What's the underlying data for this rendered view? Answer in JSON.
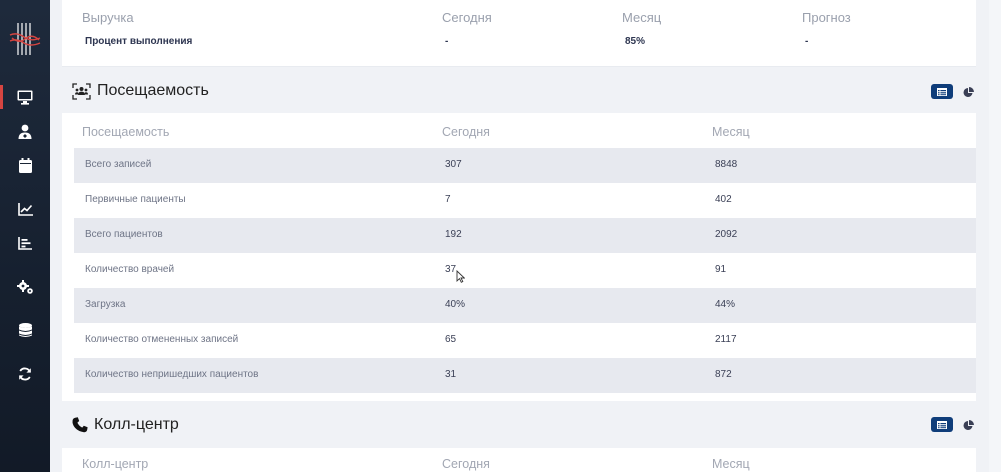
{
  "colors": {
    "sidebar": "#1a2535",
    "accent": "#d64541",
    "button": "#0f3d7a"
  },
  "sidebar": {
    "items": [
      {
        "icon": "monitor-icon",
        "active": true
      },
      {
        "icon": "doctor-icon",
        "active": false
      },
      {
        "icon": "calendar-icon",
        "active": false
      },
      {
        "icon": "line-chart-icon",
        "active": false
      },
      {
        "icon": "bar-chart-icon",
        "active": false
      },
      {
        "icon": "gears-icon",
        "active": false
      },
      {
        "icon": "database-icon",
        "active": false
      },
      {
        "icon": "sync-icon",
        "active": false
      }
    ]
  },
  "revenue": {
    "headers": [
      "Выручка",
      "Сегодня",
      "Месяц",
      "Прогноз"
    ],
    "row": {
      "label": "Процент выполнения",
      "today": "-",
      "month": "85%",
      "forecast": "-"
    }
  },
  "attendance": {
    "title": "Посещаемость",
    "headers": [
      "Посещаемость",
      "Сегодня",
      "Месяц"
    ],
    "rows": [
      {
        "name": "Всего записей",
        "today": "307",
        "month": "8848"
      },
      {
        "name": "Первичные пациенты",
        "today": "7",
        "month": "402"
      },
      {
        "name": "Всего пациентов",
        "today": "192",
        "month": "2092"
      },
      {
        "name": "Количество врачей",
        "today": "37",
        "month": "91"
      },
      {
        "name": "Загрузка",
        "today": "40%",
        "month": "44%"
      },
      {
        "name": "Количество отмененных записей",
        "today": "65",
        "month": "2117"
      },
      {
        "name": "Количество непришедших пациентов",
        "today": "31",
        "month": "872"
      }
    ]
  },
  "callcenter": {
    "title": "Колл-центр",
    "headers": [
      "Колл-центр",
      "Сегодня",
      "Месяц"
    ]
  }
}
